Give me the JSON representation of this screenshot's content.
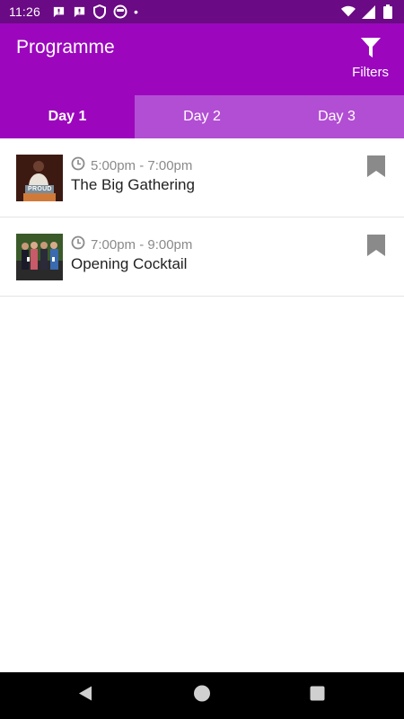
{
  "status_bar": {
    "time": "11:26",
    "dot": "•",
    "left_icons": [
      "message-icon",
      "message-icon",
      "shield-icon",
      "face-icon"
    ],
    "right_icons": [
      "wifi-icon",
      "signal-icon",
      "battery-icon"
    ]
  },
  "app_bar": {
    "title": "Programme",
    "filters_label": "Filters",
    "filters_icon": "filter-icon"
  },
  "colors": {
    "status_bar": "#6a0a84",
    "primary": "#9c07be",
    "tab_inactive": "#b24ed3",
    "muted_text": "#8a8a8a",
    "bookmark": "#8a8a8a"
  },
  "tabs": [
    {
      "label": "Day 1",
      "active": true
    },
    {
      "label": "Day 2",
      "active": false
    },
    {
      "label": "Day 3",
      "active": false
    }
  ],
  "events": [
    {
      "time": "5:00pm - 7:00pm",
      "title": "The Big Gathering",
      "thumb_caption": "PROUD",
      "bookmarked": false
    },
    {
      "time": "7:00pm - 9:00pm",
      "title": "Opening Cocktail",
      "bookmarked": false
    }
  ],
  "nav_bar": {
    "buttons": [
      "back-icon",
      "home-icon",
      "recents-icon"
    ]
  }
}
